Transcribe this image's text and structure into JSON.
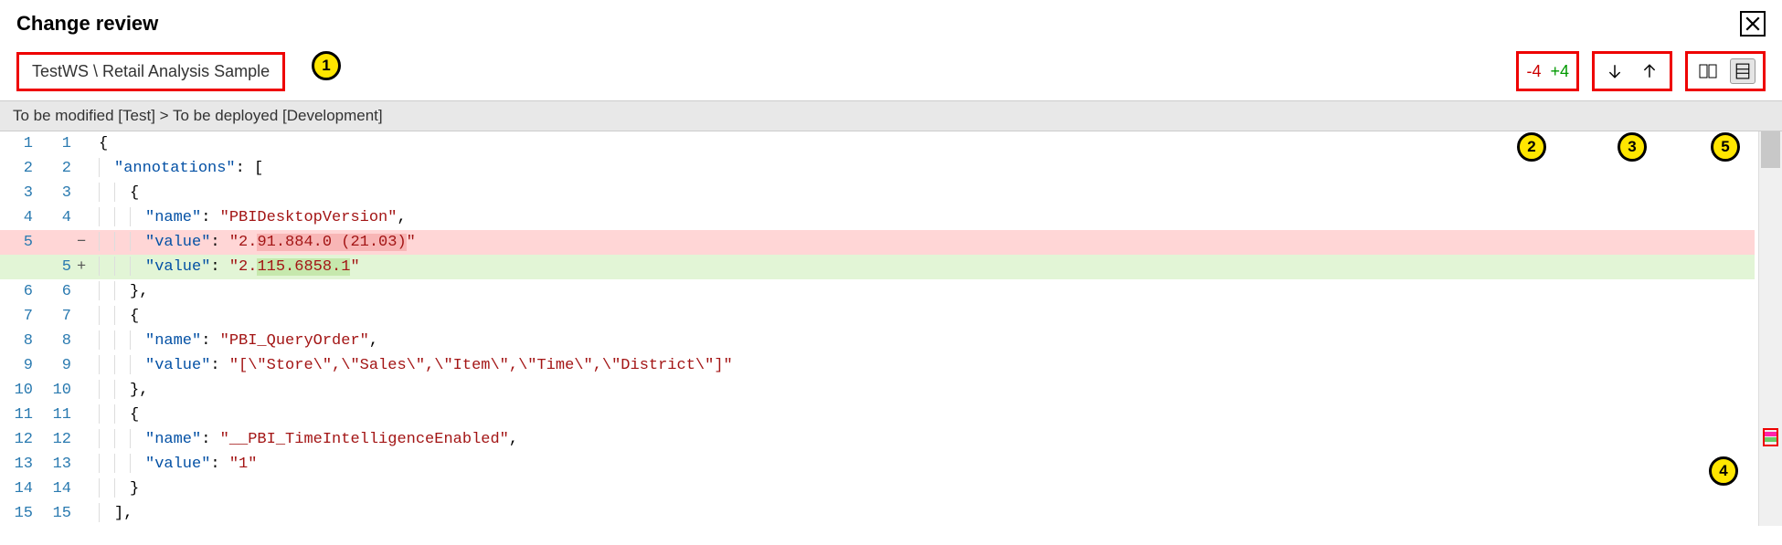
{
  "title": "Change review",
  "breadcrumb": "TestWS \\ Retail Analysis Sample",
  "diffCounts": {
    "removed": "-4",
    "added": "+4"
  },
  "nav": {
    "down": "↓",
    "up": "↑"
  },
  "viewModes": {
    "side": "side-by-side-icon",
    "inline": "inline-icon"
  },
  "subheader": "To be modified [Test] > To be deployed [Development]",
  "callouts": {
    "c1": "1",
    "c2": "2",
    "c3": "3",
    "c4": "4",
    "c5": "5"
  },
  "lines": [
    {
      "l": "1",
      "r": "1",
      "sign": "",
      "kind": "ctx",
      "segments": [
        {
          "cls": "de",
          "t": "{"
        }
      ]
    },
    {
      "l": "2",
      "r": "2",
      "sign": "",
      "kind": "ctx",
      "segments": [
        {
          "cls": "ind",
          "t": ""
        },
        {
          "cls": "key",
          "t": "\"annotations\""
        },
        {
          "cls": "pun",
          "t": ": ["
        }
      ]
    },
    {
      "l": "3",
      "r": "3",
      "sign": "",
      "kind": "ctx",
      "segments": [
        {
          "cls": "ind",
          "t": ""
        },
        {
          "cls": "ind",
          "t": ""
        },
        {
          "cls": "de",
          "t": "{"
        }
      ]
    },
    {
      "l": "4",
      "r": "4",
      "sign": "",
      "kind": "ctx",
      "segments": [
        {
          "cls": "ind",
          "t": ""
        },
        {
          "cls": "ind",
          "t": ""
        },
        {
          "cls": "ind",
          "t": ""
        },
        {
          "cls": "key",
          "t": "\"name\""
        },
        {
          "cls": "pun",
          "t": ": "
        },
        {
          "cls": "str",
          "t": "\"PBIDesktopVersion\""
        },
        {
          "cls": "pun",
          "t": ","
        }
      ]
    },
    {
      "l": "5",
      "r": "",
      "sign": "−",
      "kind": "del",
      "segments": [
        {
          "cls": "ind",
          "t": ""
        },
        {
          "cls": "ind",
          "t": ""
        },
        {
          "cls": "ind",
          "t": ""
        },
        {
          "cls": "key",
          "t": "\"value\""
        },
        {
          "cls": "pun",
          "t": ": "
        },
        {
          "cls": "str",
          "t": "\"2."
        },
        {
          "cls": "str hl-del",
          "t": "91.884.0 (21.03)"
        },
        {
          "cls": "str",
          "t": "\""
        }
      ]
    },
    {
      "l": "",
      "r": "5",
      "sign": "+",
      "kind": "add",
      "segments": [
        {
          "cls": "ind",
          "t": ""
        },
        {
          "cls": "ind",
          "t": ""
        },
        {
          "cls": "ind",
          "t": ""
        },
        {
          "cls": "key",
          "t": "\"value\""
        },
        {
          "cls": "pun",
          "t": ": "
        },
        {
          "cls": "str",
          "t": "\"2."
        },
        {
          "cls": "str hl-add",
          "t": "115.6858.1"
        },
        {
          "cls": "str",
          "t": "\""
        }
      ]
    },
    {
      "l": "6",
      "r": "6",
      "sign": "",
      "kind": "ctx",
      "segments": [
        {
          "cls": "ind",
          "t": ""
        },
        {
          "cls": "ind",
          "t": ""
        },
        {
          "cls": "de",
          "t": "},"
        }
      ]
    },
    {
      "l": "7",
      "r": "7",
      "sign": "",
      "kind": "ctx",
      "segments": [
        {
          "cls": "ind",
          "t": ""
        },
        {
          "cls": "ind",
          "t": ""
        },
        {
          "cls": "de",
          "t": "{"
        }
      ]
    },
    {
      "l": "8",
      "r": "8",
      "sign": "",
      "kind": "ctx",
      "segments": [
        {
          "cls": "ind",
          "t": ""
        },
        {
          "cls": "ind",
          "t": ""
        },
        {
          "cls": "ind",
          "t": ""
        },
        {
          "cls": "key",
          "t": "\"name\""
        },
        {
          "cls": "pun",
          "t": ": "
        },
        {
          "cls": "str",
          "t": "\"PBI_QueryOrder\""
        },
        {
          "cls": "pun",
          "t": ","
        }
      ]
    },
    {
      "l": "9",
      "r": "9",
      "sign": "",
      "kind": "ctx",
      "segments": [
        {
          "cls": "ind",
          "t": ""
        },
        {
          "cls": "ind",
          "t": ""
        },
        {
          "cls": "ind",
          "t": ""
        },
        {
          "cls": "key",
          "t": "\"value\""
        },
        {
          "cls": "pun",
          "t": ": "
        },
        {
          "cls": "str",
          "t": "\"[\\\"Store\\\",\\\"Sales\\\",\\\"Item\\\",\\\"Time\\\",\\\"District\\\"]\""
        }
      ]
    },
    {
      "l": "10",
      "r": "10",
      "sign": "",
      "kind": "ctx",
      "segments": [
        {
          "cls": "ind",
          "t": ""
        },
        {
          "cls": "ind",
          "t": ""
        },
        {
          "cls": "de",
          "t": "},"
        }
      ]
    },
    {
      "l": "11",
      "r": "11",
      "sign": "",
      "kind": "ctx",
      "segments": [
        {
          "cls": "ind",
          "t": ""
        },
        {
          "cls": "ind",
          "t": ""
        },
        {
          "cls": "de",
          "t": "{"
        }
      ]
    },
    {
      "l": "12",
      "r": "12",
      "sign": "",
      "kind": "ctx",
      "segments": [
        {
          "cls": "ind",
          "t": ""
        },
        {
          "cls": "ind",
          "t": ""
        },
        {
          "cls": "ind",
          "t": ""
        },
        {
          "cls": "key",
          "t": "\"name\""
        },
        {
          "cls": "pun",
          "t": ": "
        },
        {
          "cls": "str",
          "t": "\"__PBI_TimeIntelligenceEnabled\""
        },
        {
          "cls": "pun",
          "t": ","
        }
      ]
    },
    {
      "l": "13",
      "r": "13",
      "sign": "",
      "kind": "ctx",
      "segments": [
        {
          "cls": "ind",
          "t": ""
        },
        {
          "cls": "ind",
          "t": ""
        },
        {
          "cls": "ind",
          "t": ""
        },
        {
          "cls": "key",
          "t": "\"value\""
        },
        {
          "cls": "pun",
          "t": ": "
        },
        {
          "cls": "str",
          "t": "\"1\""
        }
      ]
    },
    {
      "l": "14",
      "r": "14",
      "sign": "",
      "kind": "ctx",
      "segments": [
        {
          "cls": "ind",
          "t": ""
        },
        {
          "cls": "ind",
          "t": ""
        },
        {
          "cls": "de",
          "t": "}"
        }
      ]
    },
    {
      "l": "15",
      "r": "15",
      "sign": "",
      "kind": "ctx",
      "segments": [
        {
          "cls": "ind",
          "t": ""
        },
        {
          "cls": "de",
          "t": "],"
        }
      ]
    }
  ]
}
